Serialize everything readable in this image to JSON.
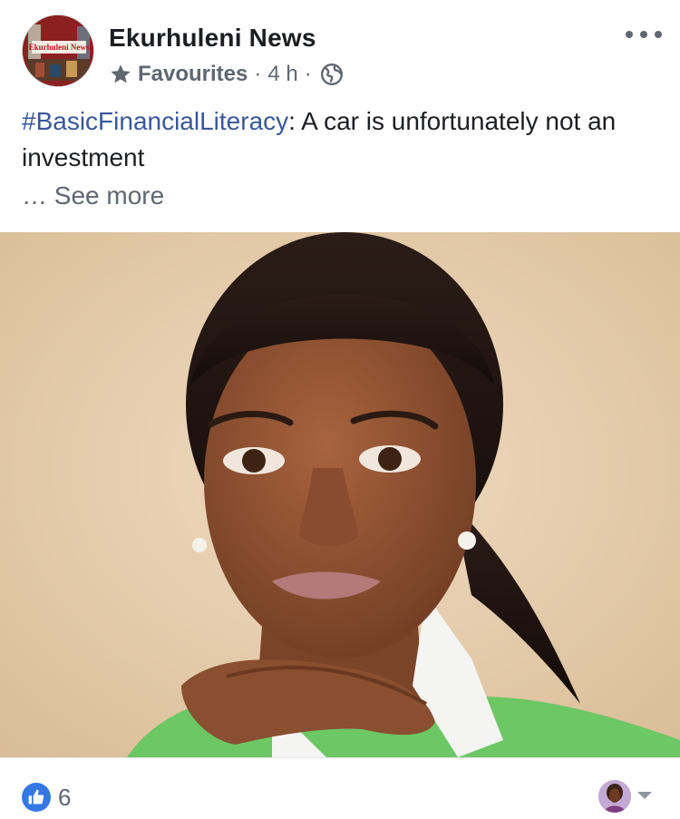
{
  "post": {
    "page_name": "Ekurhuleni News",
    "avatar_label": "Ekurhuleni News",
    "audience_label": "Favourites",
    "separator": "·",
    "time_ago": "4 h",
    "hashtag": "#BasicFinancialLiteracy",
    "body_text": ": A car is unfortunately not an investment",
    "see_more_label": "… See more",
    "icons": {
      "audience": "star-icon",
      "privacy": "globe-icon",
      "menu": "more-options-icon",
      "reaction": "like-icon",
      "expand": "caret-down-icon"
    }
  },
  "reactions": {
    "like_count": "6"
  },
  "colors": {
    "hashtag": "#385898",
    "like_blue": "#3578e5",
    "secondary_text": "#606770",
    "photo_background": "#e6cfb0",
    "sweater_green": "#6cc765"
  }
}
